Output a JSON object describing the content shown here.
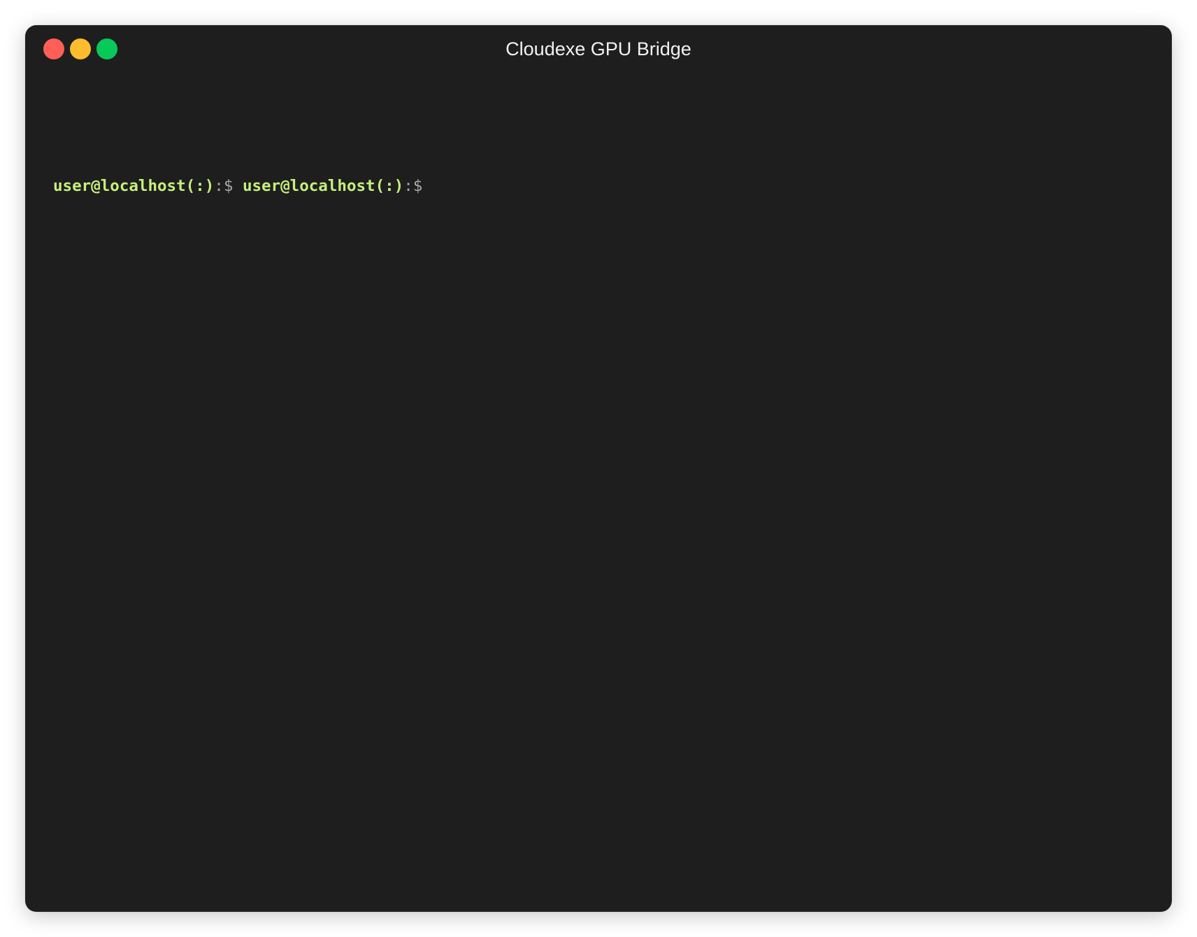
{
  "window": {
    "title": "Cloudexe GPU Bridge",
    "controls": {
      "close_color": "#ff5f57",
      "minimize_color": "#febc2e",
      "maximize_color": "#07c95a"
    }
  },
  "terminal": {
    "background": "#1e1e1e",
    "prompt_color": "#c6ef7c",
    "lines": [
      {
        "segments": [
          {
            "user_host": "user@localhost(:)",
            "symbol": ":$"
          },
          {
            "user_host": "user@localhost(:)",
            "symbol": ":$"
          }
        ]
      }
    ]
  }
}
